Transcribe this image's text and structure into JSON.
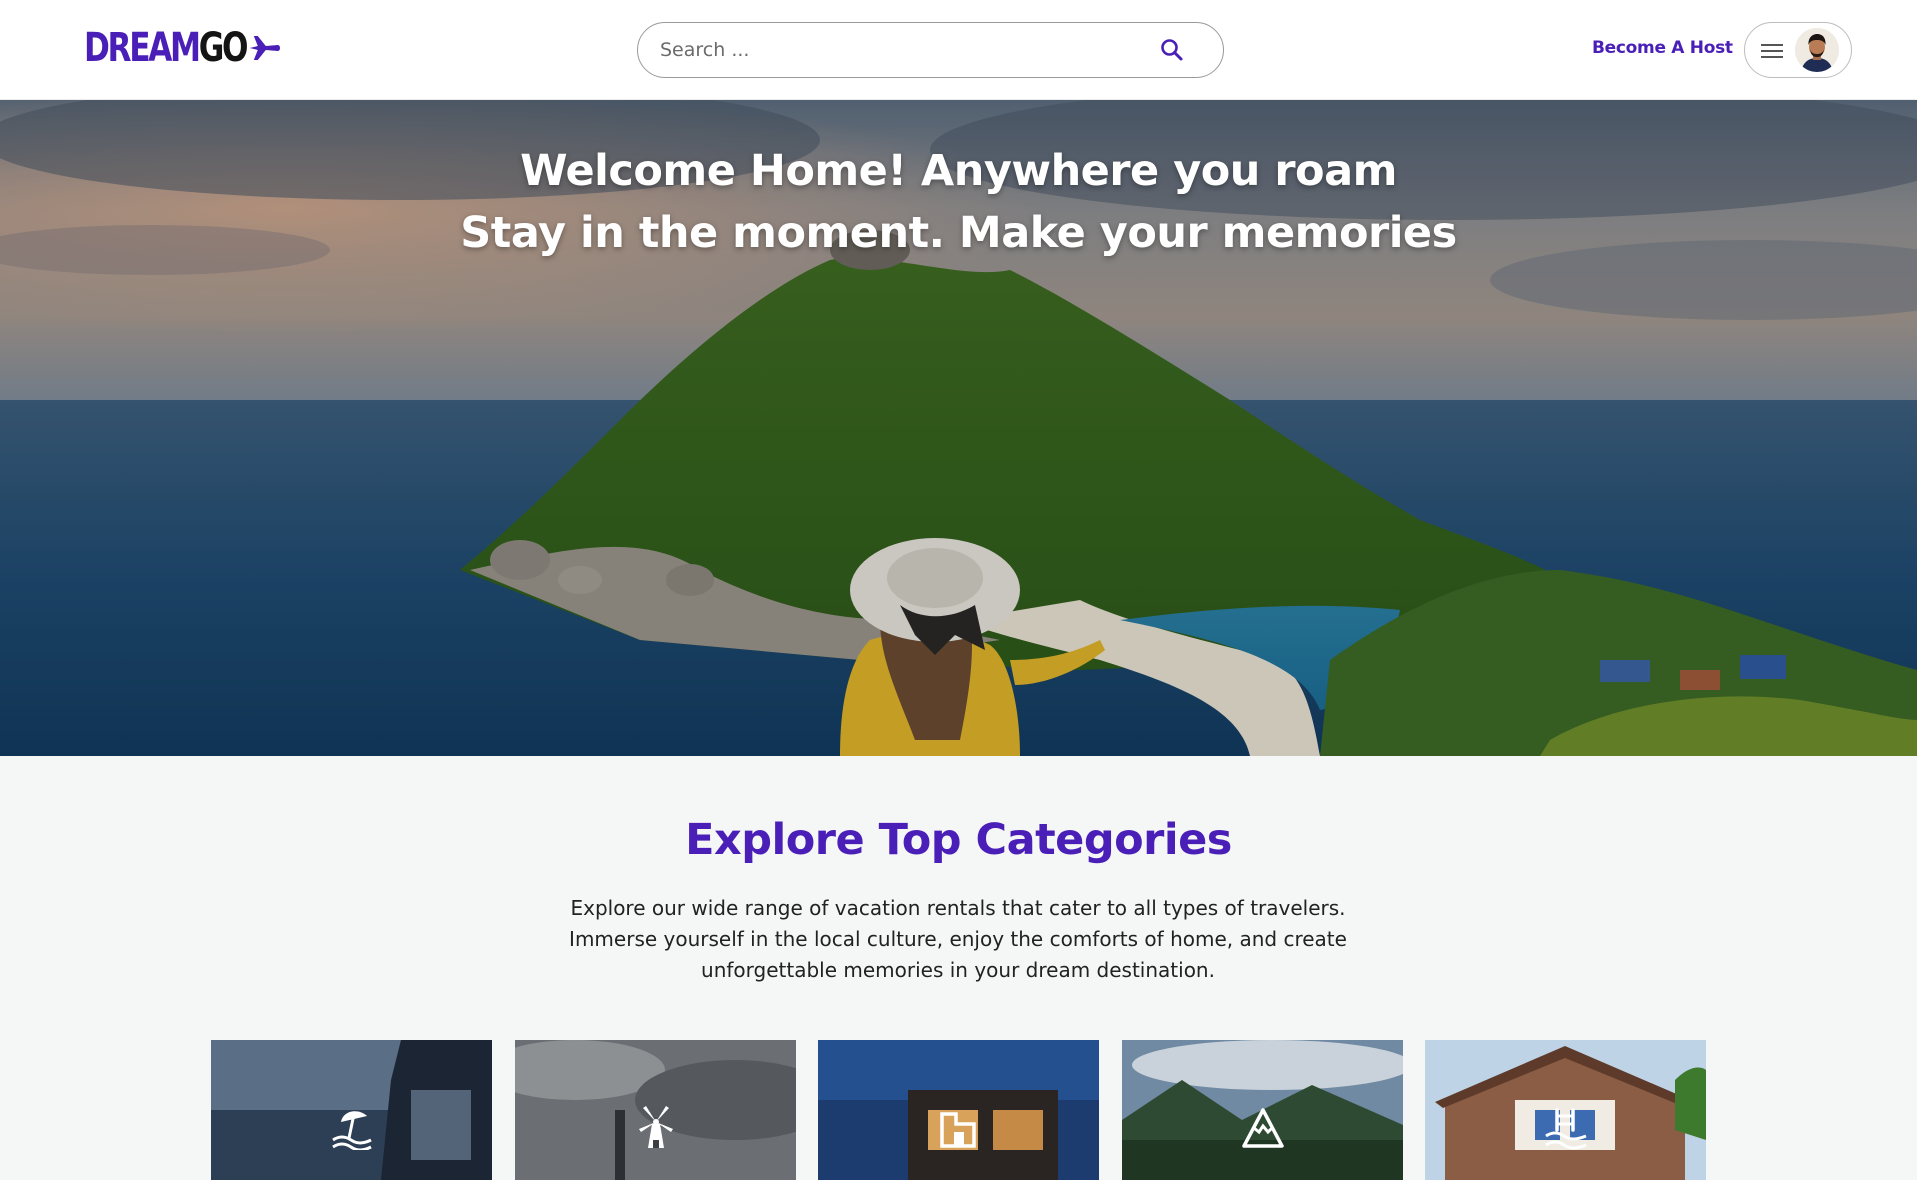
{
  "header": {
    "logo": {
      "part1": "DREAM",
      "part2": "GO",
      "icon": "airplane-icon"
    },
    "search": {
      "placeholder": "Search ...",
      "icon": "search-icon"
    },
    "become_host": "Become A Host",
    "user_menu": {
      "menu_icon": "hamburger-menu-icon",
      "avatar": "user-avatar"
    }
  },
  "hero": {
    "line1": "Welcome Home! Anywhere you roam",
    "line2": "Stay in the moment. Make your memories"
  },
  "categories": {
    "title": "Explore Top Categories",
    "description": "Explore our wide range of vacation rentals that cater to all types of travelers. Immerse yourself in the local culture, enjoy the comforts of home, and create unforgettable memories in your dream destination.",
    "items": [
      {
        "icon": "beach-umbrella-icon"
      },
      {
        "icon": "windmill-icon"
      },
      {
        "icon": "modern-home-icon"
      },
      {
        "icon": "mountain-icon"
      },
      {
        "icon": "pool-icon"
      }
    ]
  },
  "colors": {
    "brand": "#4a1fb8",
    "text_dark": "#222222",
    "background": "#f5f6f6"
  }
}
